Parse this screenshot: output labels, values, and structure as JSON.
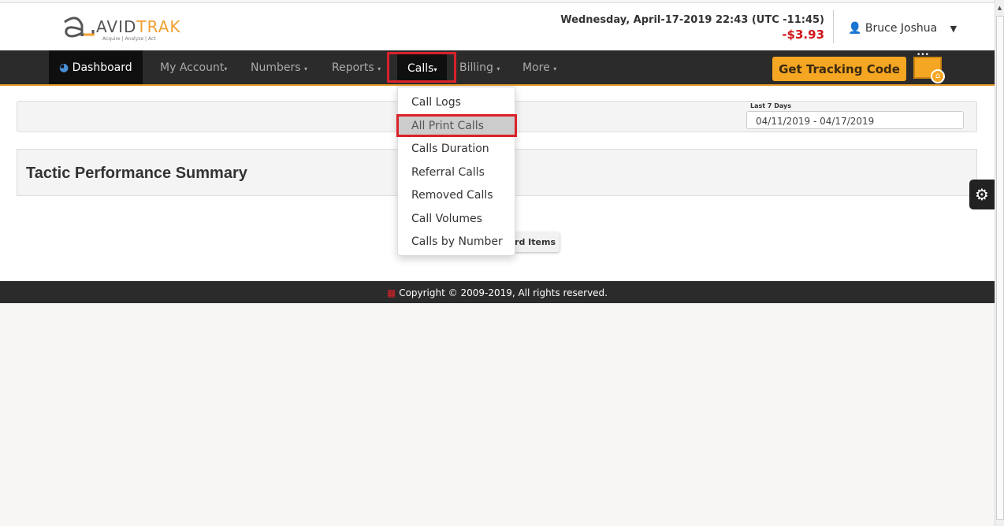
{
  "header": {
    "logo_text": "AVIDTRAK",
    "logo_tagline": "Acquire | Analyze | Act",
    "datetime": "Wednesday, April-17-2019 22:43 (UTC -11:45)",
    "balance": "-$3.93",
    "user": "Bruce Joshua"
  },
  "nav": {
    "items": [
      {
        "label": "Dashboard"
      },
      {
        "label": "My Account"
      },
      {
        "label": "Numbers"
      },
      {
        "label": "Reports"
      },
      {
        "label": "Calls"
      },
      {
        "label": "Billing"
      },
      {
        "label": "More"
      }
    ],
    "cta": "Get Tracking Code"
  },
  "calls_menu": {
    "items": [
      "Call Logs",
      "All Print Calls",
      "Calls Duration",
      "Referral Calls",
      "Removed Calls",
      "Call Volumes",
      "Calls by Number"
    ],
    "highlighted": "All Print Calls"
  },
  "filter": {
    "label": "Last 7 Days",
    "range": "04/11/2019 - 04/17/2019"
  },
  "panel": {
    "title": "Tactic Performance Summary"
  },
  "add_button": "ard Items",
  "footer": {
    "text": "Copyright © 2009-2019, All rights reserved."
  },
  "colors": {
    "accent": "#f5a623",
    "nav_bg": "#2b2b2b",
    "highlight_box": "#d9222a",
    "balance": "#d0141a"
  }
}
